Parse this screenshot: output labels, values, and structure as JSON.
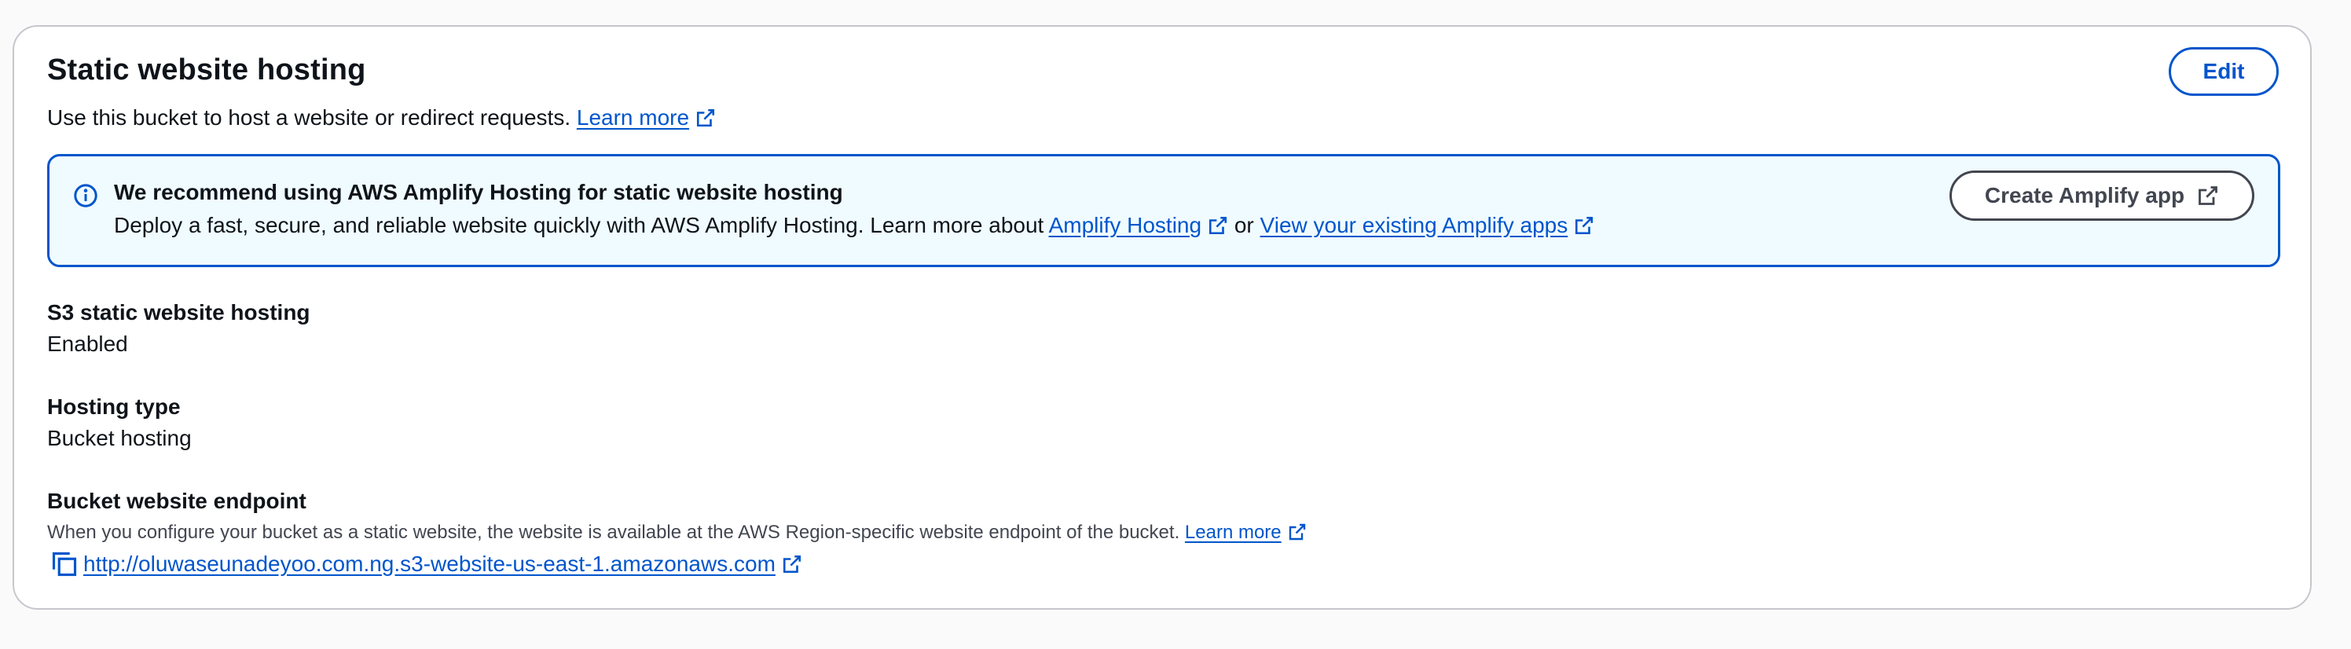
{
  "panel": {
    "title": "Static website hosting",
    "description": "Use this bucket to host a website or redirect requests.",
    "learn_more": "Learn more",
    "edit_label": "Edit"
  },
  "alert": {
    "icon": "info-icon",
    "title": "We recommend using AWS Amplify Hosting for static website hosting",
    "body_prefix": "Deploy a fast, secure, and reliable website quickly with AWS Amplify Hosting. Learn more about",
    "link_amplify": "Amplify Hosting",
    "connector": "or",
    "link_existing": "View your existing Amplify apps",
    "button_label": "Create Amplify app"
  },
  "properties": [
    {
      "label": "S3 static website hosting",
      "value": "Enabled"
    },
    {
      "label": "Hosting type",
      "value": "Bucket hosting"
    }
  ],
  "endpoint": {
    "label": "Bucket website endpoint",
    "description": "When you configure your bucket as a static website, the website is available at the AWS Region-specific website endpoint of the bucket.",
    "learn_more": "Learn more",
    "url": "http://oluwaseunadeyoo.com.ng.s3-website-us-east-1.amazonaws.com"
  },
  "colors": {
    "link": "#0055cc",
    "alert_bg": "#f0fbff",
    "border": "#c6c6cd",
    "text": "#0f141a"
  }
}
